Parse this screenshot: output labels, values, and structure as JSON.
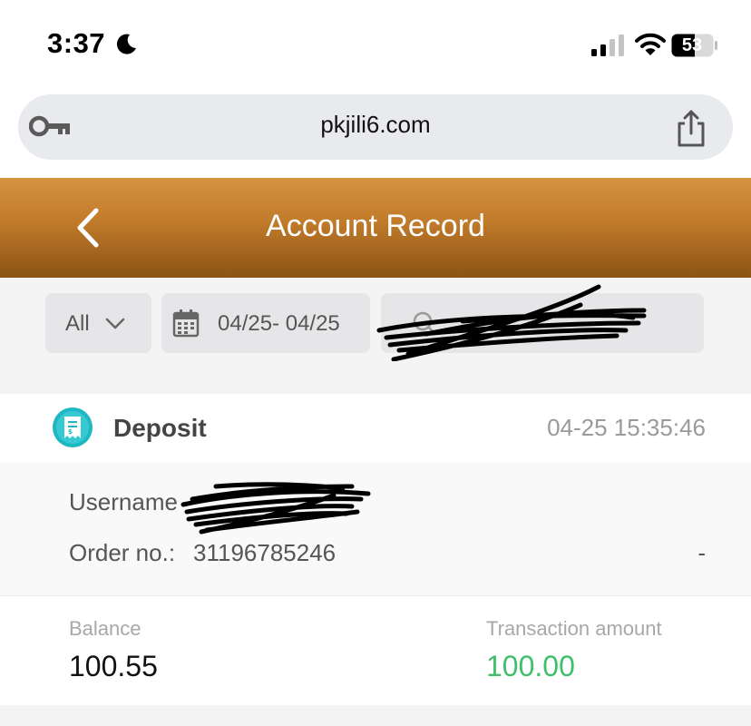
{
  "status_bar": {
    "time": "3:37",
    "battery": "53"
  },
  "browser": {
    "url": "pkjili6.com"
  },
  "header": {
    "title": "Account Record"
  },
  "filters": {
    "type": "All",
    "date_range": "04/25- 04/25"
  },
  "record": {
    "type": "Deposit",
    "datetime": "04-25 15:35:46",
    "username_label": "Username",
    "order_label": "Order no.:",
    "order_number": "31196785246",
    "status": "-",
    "balance_label": "Balance",
    "balance": "100.55",
    "amount_label": "Transaction amount",
    "amount": "100.00"
  },
  "colors": {
    "header_gradient_top": "#d69340",
    "header_gradient_bottom": "#8a5314",
    "amount_green": "#3fbf6b",
    "icon_teal": "#1fb8c2"
  }
}
